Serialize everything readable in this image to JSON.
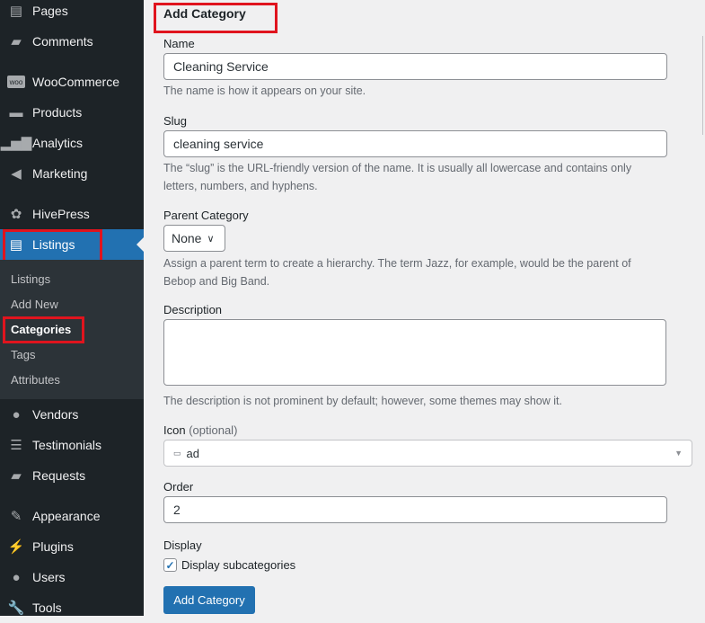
{
  "sidebar": {
    "items": [
      {
        "label": "Pages",
        "icon": "pages-icon"
      },
      {
        "label": "Comments",
        "icon": "comments-icon"
      },
      {
        "label": "WooCommerce",
        "icon": "woocommerce-icon"
      },
      {
        "label": "Products",
        "icon": "products-icon"
      },
      {
        "label": "Analytics",
        "icon": "analytics-icon"
      },
      {
        "label": "Marketing",
        "icon": "megaphone-icon"
      },
      {
        "label": "HivePress",
        "icon": "hivepress-icon"
      },
      {
        "label": "Listings",
        "icon": "listings-icon"
      },
      {
        "label": "Vendors",
        "icon": "vendors-icon"
      },
      {
        "label": "Testimonials",
        "icon": "testimonials-icon"
      },
      {
        "label": "Requests",
        "icon": "requests-icon"
      },
      {
        "label": "Appearance",
        "icon": "appearance-icon"
      },
      {
        "label": "Plugins",
        "icon": "plugins-icon"
      },
      {
        "label": "Users",
        "icon": "users-icon"
      },
      {
        "label": "Tools",
        "icon": "tools-icon"
      }
    ],
    "submenu": [
      "Listings",
      "Add New",
      "Categories",
      "Tags",
      "Attributes"
    ]
  },
  "form": {
    "title": "Add Category",
    "name_label": "Name",
    "name_value": "Cleaning Service",
    "name_desc": "The name is how it appears on your site.",
    "slug_label": "Slug",
    "slug_value": "cleaning service",
    "slug_desc": "The “slug” is the URL-friendly version of the name. It is usually all lowercase and contains only letters, numbers, and hyphens.",
    "parent_label": "Parent Category",
    "parent_value": "None",
    "parent_desc": "Assign a parent term to create a hierarchy. The term Jazz, for example, would be the parent of Bebop and Big Band.",
    "description_label": "Description",
    "description_value": "",
    "description_desc": "The description is not prominent by default; however, some themes may show it.",
    "icon_label": "Icon",
    "icon_optional": "(optional)",
    "icon_value": "ad",
    "order_label": "Order",
    "order_value": "2",
    "display_label": "Display",
    "display_checkbox": "Display subcategories",
    "display_checked": true,
    "submit": "Add Category"
  },
  "colors": {
    "sidebar": "#1d2327",
    "accent": "#2271b1",
    "highlight": "#e0141e"
  }
}
